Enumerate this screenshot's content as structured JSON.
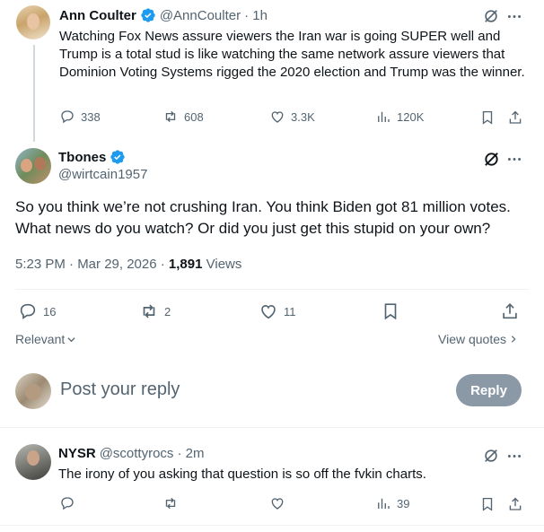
{
  "colors": {
    "accent": "#1d9bf0",
    "muted": "#536471",
    "text": "#0f1419",
    "divider": "#eff3f4",
    "reply_btn": "#8b98a5"
  },
  "quoted_tweet": {
    "author_name": "Ann Coulter",
    "handle": "@AnnCoulter",
    "time": "· 1h",
    "text": "Watching Fox News assure viewers the Iran war is going SUPER well and Trump is a total stud is like watching the same network assure viewers that Dominion Voting Systems rigged the 2020 election and Trump was the winner.",
    "stats": {
      "replies": "338",
      "reposts": "608",
      "likes": "3.3K",
      "views": "120K"
    }
  },
  "main_tweet": {
    "author_name": "Tbones",
    "handle": "@wirtcain1957",
    "text": "So you think we’re not crushing Iran. You think Biden got 81 million votes. What news do you watch? Or did you just get this stupid on your own?",
    "timestamp": "5:23 PM · Mar 29, 2026 ·",
    "views_count": "1,891",
    "views_label": "Views",
    "stats": {
      "replies": "16",
      "reposts": "2",
      "likes": "11"
    }
  },
  "sort": {
    "label": "Relevant",
    "view_quotes": "View quotes"
  },
  "composer": {
    "placeholder": "Post your reply",
    "reply_button": "Reply"
  },
  "reply": {
    "author_name": "NYSR",
    "handle": "@scottyrocs",
    "time": "· 2m",
    "text": "The irony of you asking that question is so off the fvkin charts.",
    "stats": {
      "views": "39"
    }
  },
  "icons": [
    "verified-badge-icon",
    "grok-icon",
    "more-icon",
    "reply-icon",
    "repost-icon",
    "like-icon",
    "views-icon",
    "bookmark-icon",
    "share-icon",
    "chevron-down-icon",
    "chevron-right-icon"
  ]
}
